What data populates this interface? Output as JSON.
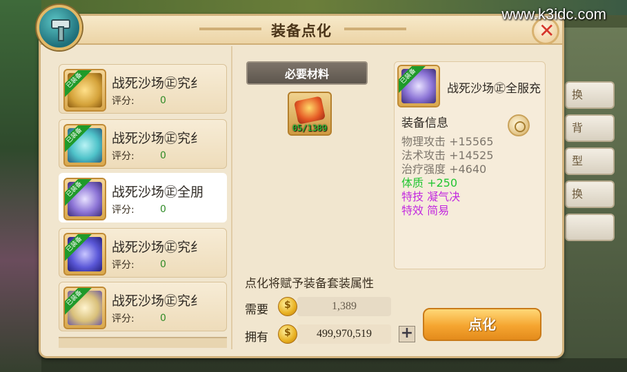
{
  "watermark": "www.k3idc.com",
  "dialog": {
    "title": "装备点化",
    "close_label": "✕"
  },
  "equipment_list": [
    {
      "name": "战死沙场㊣究纟",
      "score_label": "评分:",
      "score": "0",
      "equipped": "已装备",
      "color": "#d4a23a",
      "selected": false
    },
    {
      "name": "战死沙场㊣究纟",
      "score_label": "评分:",
      "score": "0",
      "equipped": "已装备",
      "color": "#4ec2c9",
      "selected": false
    },
    {
      "name": "战死沙场㊣全朋",
      "score_label": "评分:",
      "score": "0",
      "equipped": "已装备",
      "color": "#8c74d6",
      "selected": true
    },
    {
      "name": "战死沙场㊣究纟",
      "score_label": "评分:",
      "score": "0",
      "equipped": "已装备",
      "color": "#5b58d8",
      "selected": false
    },
    {
      "name": "战死沙场㊣究纟",
      "score_label": "评分:",
      "score": "0",
      "equipped": "已装备",
      "color": "#d9c07a",
      "selected": false
    }
  ],
  "materials": {
    "banner": "必要材料",
    "count": "05/1389"
  },
  "description": "点化将赋予装备套装属性",
  "cost": {
    "need_label": "需要",
    "need_value": "1,389",
    "have_label": "拥有",
    "have_value": "499,970,519",
    "plus_label": "+"
  },
  "info": {
    "equipped_tag": "已装备",
    "name": "战死沙场㊣全服充",
    "section_title": "装备信息",
    "stats": [
      {
        "text": "物理攻击 +15565",
        "style": "gray"
      },
      {
        "text": "法术攻击 +14525",
        "style": "gray"
      },
      {
        "text": "治疗强度 +4640",
        "style": "gray"
      },
      {
        "text": "体质 +250",
        "style": "green"
      },
      {
        "text": "特技 凝气决",
        "style": "purple"
      },
      {
        "text": "特效 简易",
        "style": "purple"
      }
    ]
  },
  "action_button": "点化",
  "side_buttons": [
    "换",
    "背",
    "型",
    "换",
    ""
  ]
}
